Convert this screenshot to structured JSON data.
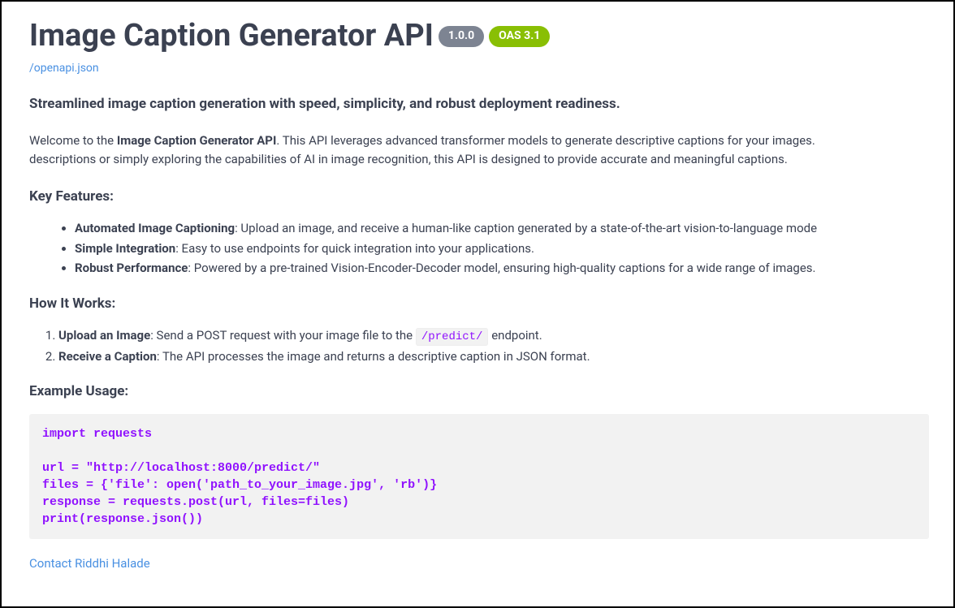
{
  "header": {
    "title": "Image Caption Generator API",
    "version_badge": "1.0.0",
    "oas_badge": "OAS 3.1",
    "spec_link": "/openapi.json"
  },
  "tagline": "Streamlined image caption generation with speed, simplicity, and robust deployment readiness.",
  "intro": {
    "prefix": "Welcome to the ",
    "bold": "Image Caption Generator API",
    "line1_rest": ". This API leverages advanced transformer models to generate descriptive captions for your images.",
    "line2": "descriptions or simply exploring the capabilities of AI in image recognition, this API is designed to provide accurate and meaningful captions."
  },
  "features": {
    "heading": "Key Features:",
    "items": [
      {
        "bold": "Automated Image Captioning",
        "rest": ": Upload an image, and receive a human-like caption generated by a state-of-the-art vision-to-language mode"
      },
      {
        "bold": "Simple Integration",
        "rest": ": Easy to use endpoints for quick integration into your applications."
      },
      {
        "bold": "Robust Performance",
        "rest": ": Powered by a pre-trained Vision-Encoder-Decoder model, ensuring high-quality captions for a wide range of images."
      }
    ]
  },
  "how": {
    "heading": "How It Works:",
    "steps": [
      {
        "bold": "Upload an Image",
        "pre": ": Send a POST request with your image file to the ",
        "code": "/predict/",
        "post": " endpoint."
      },
      {
        "bold": "Receive a Caption",
        "pre": ": The API processes the image and returns a descriptive caption in JSON format.",
        "code": "",
        "post": ""
      }
    ]
  },
  "example": {
    "heading": "Example Usage:",
    "code": "import requests\n\nurl = \"http://localhost:8000/predict/\"\nfiles = {'file': open('path_to_your_image.jpg', 'rb')}\nresponse = requests.post(url, files=files)\nprint(response.json())"
  },
  "contact": {
    "label": "Contact Riddhi Halade"
  }
}
